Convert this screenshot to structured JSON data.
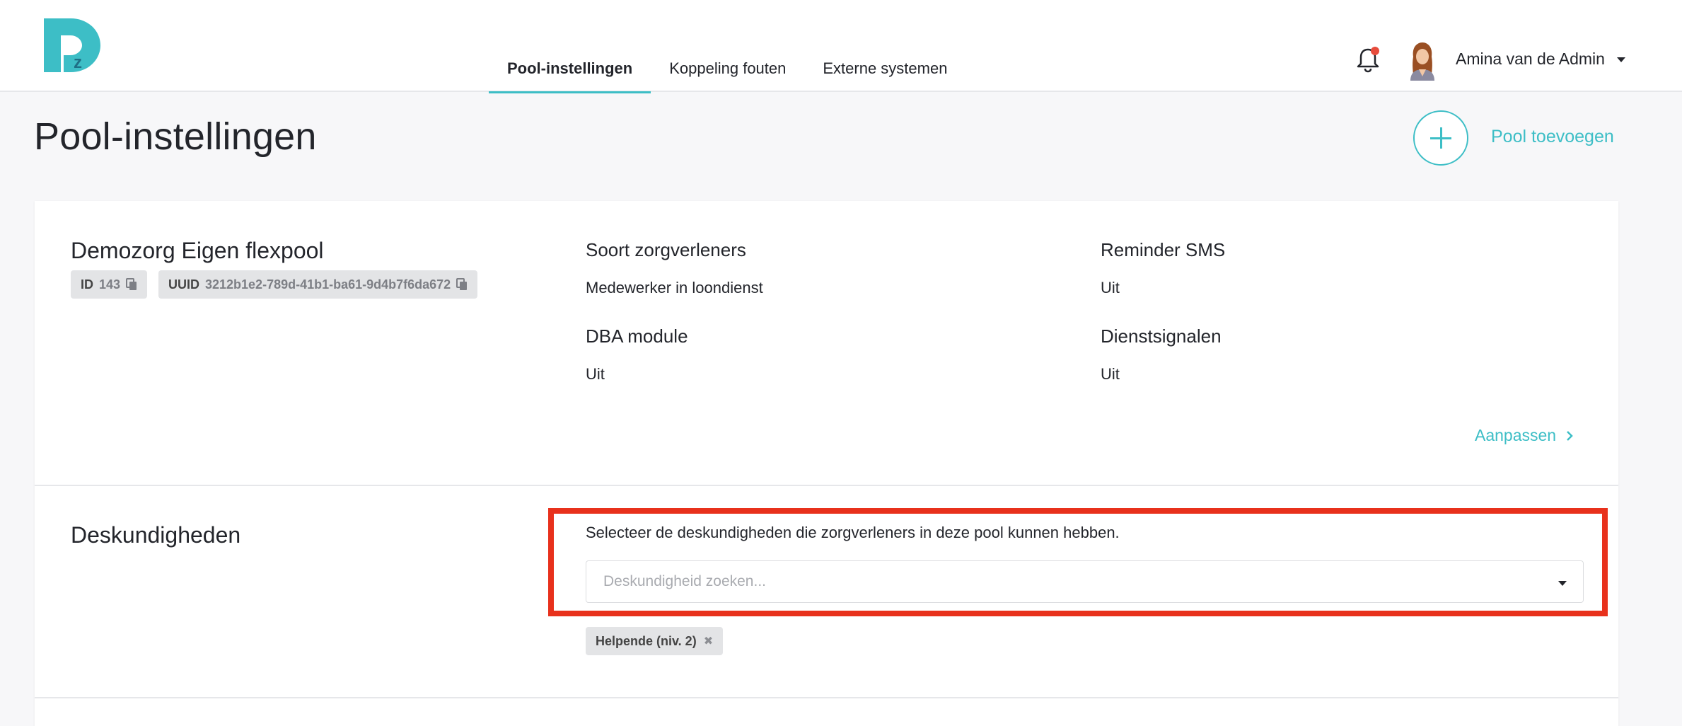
{
  "header": {
    "tabs": [
      {
        "label": "Pool-instellingen",
        "active": true
      },
      {
        "label": "Koppeling fouten",
        "active": false
      },
      {
        "label": "Externe systemen",
        "active": false
      }
    ],
    "user_name": "Amina van de Admin",
    "icons": [
      "logo-dz",
      "bell-icon",
      "avatar",
      "caret-down-icon"
    ],
    "notification_dot_color": "#e74c3c"
  },
  "page": {
    "title": "Pool-instellingen",
    "add_pool_label": "Pool toevoegen"
  },
  "pool": {
    "name": "Demozorg Eigen flexpool",
    "id_label": "ID",
    "id_value": "143",
    "uuid_label": "UUID",
    "uuid_value": "3212b1e2-789d-41b1-ba61-9d4b7f6da672",
    "fields": [
      {
        "label": "Soort zorgverleners",
        "value": "Medewerker in loondienst"
      },
      {
        "label": "Reminder SMS",
        "value": "Uit"
      },
      {
        "label": "DBA module",
        "value": "Uit"
      },
      {
        "label": "Dienstsignalen",
        "value": "Uit"
      }
    ],
    "edit_label": "Aanpassen"
  },
  "expertise": {
    "title": "Deskundigheden",
    "hint": "Selecteer de deskundigheden die zorgverleners in deze pool kunnen hebben.",
    "search_placeholder": "Deskundigheid zoeken...",
    "selected": [
      {
        "label": "Helpende (niv. 2)"
      }
    ]
  },
  "colors": {
    "accent": "#3dbec6",
    "highlight": "#e8311c",
    "text": "#23252b"
  }
}
